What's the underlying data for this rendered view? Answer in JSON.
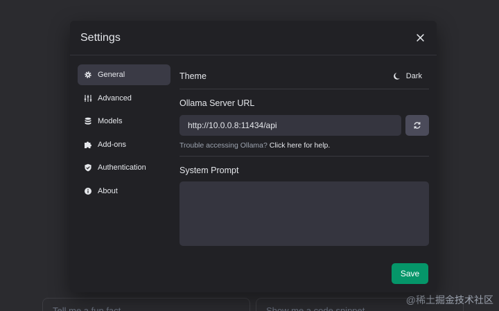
{
  "background": {
    "suggestions": [
      "Tell me a fun fact",
      "Show me a code snippet"
    ],
    "watermark": "@稀土掘金技术社区"
  },
  "modal": {
    "title": "Settings",
    "sidebar": {
      "items": [
        {
          "label": "General",
          "icon": "gear-icon",
          "active": true
        },
        {
          "label": "Advanced",
          "icon": "sliders-icon",
          "active": false
        },
        {
          "label": "Models",
          "icon": "database-icon",
          "active": false
        },
        {
          "label": "Add-ons",
          "icon": "puzzle-icon",
          "active": false
        },
        {
          "label": "Authentication",
          "icon": "shield-icon",
          "active": false
        },
        {
          "label": "About",
          "icon": "info-icon",
          "active": false
        }
      ]
    },
    "theme": {
      "label": "Theme",
      "value": "Dark"
    },
    "server": {
      "label": "Ollama Server URL",
      "value": "http://10.0.0.8:11434/api",
      "help_prefix": "Trouble accessing Ollama?",
      "help_link": "Click here for help."
    },
    "system_prompt": {
      "label": "System Prompt",
      "value": ""
    },
    "save_label": "Save"
  },
  "colors": {
    "accent": "#059669",
    "modal_bg": "#212125",
    "input_bg": "#35353f"
  }
}
